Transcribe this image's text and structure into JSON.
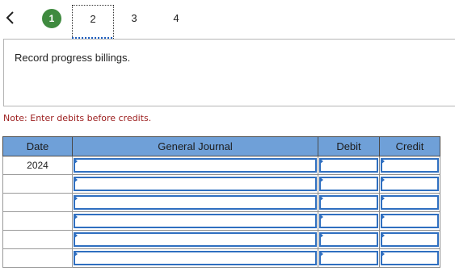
{
  "nav": {
    "steps": [
      {
        "label": "1",
        "state": "done"
      },
      {
        "label": "2",
        "state": "current"
      },
      {
        "label": "3",
        "state": "upcoming"
      },
      {
        "label": "4",
        "state": "upcoming"
      }
    ],
    "back_icon": "chevron-left-icon",
    "done_color": "#3f8a3f"
  },
  "instruction": {
    "text": "Record progress billings."
  },
  "note": {
    "text": "Note: Enter debits before credits."
  },
  "journal": {
    "header_color": "#6fa0d8",
    "columns": [
      "Date",
      "General Journal",
      "Debit",
      "Credit"
    ],
    "rows": [
      {
        "date": "2024",
        "account": "",
        "debit": "",
        "credit": ""
      },
      {
        "date": "",
        "account": "",
        "debit": "",
        "credit": ""
      },
      {
        "date": "",
        "account": "",
        "debit": "",
        "credit": ""
      },
      {
        "date": "",
        "account": "",
        "debit": "",
        "credit": ""
      },
      {
        "date": "",
        "account": "",
        "debit": "",
        "credit": ""
      },
      {
        "date": "",
        "account": "",
        "debit": "",
        "credit": ""
      }
    ]
  }
}
